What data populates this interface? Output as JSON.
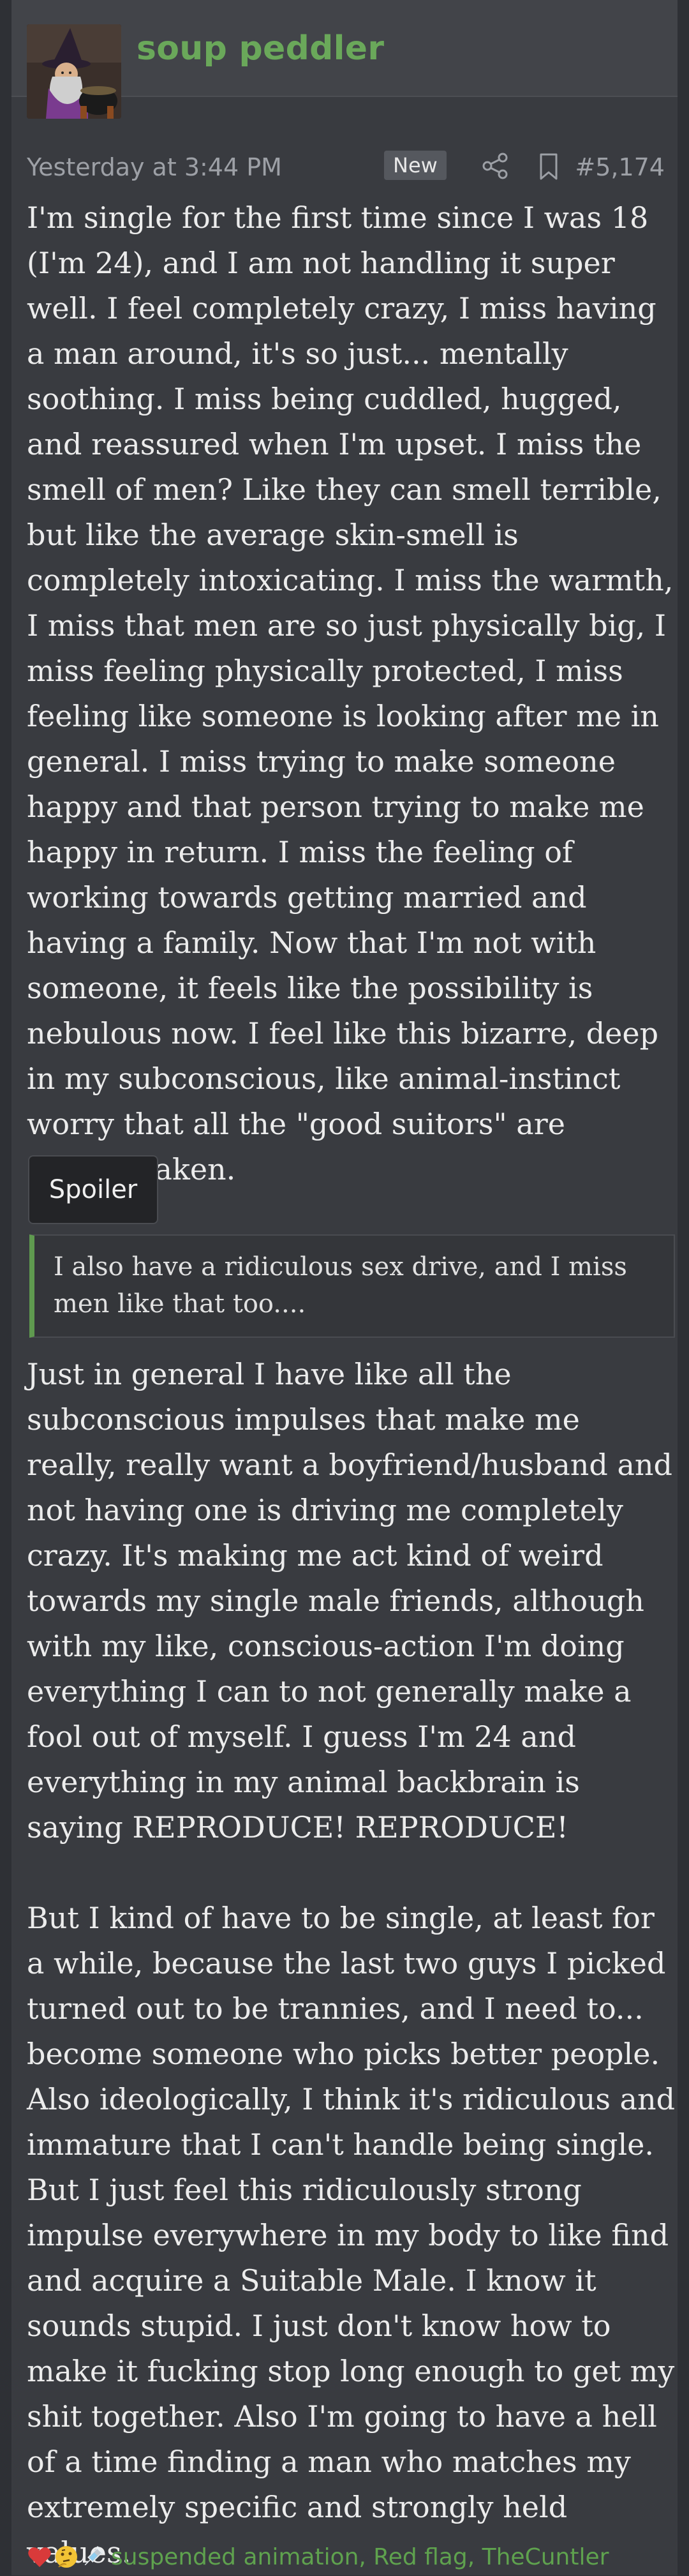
{
  "user": {
    "name": "soup peddler",
    "avatar_icon": "witch-with-cauldron-avatar"
  },
  "post": {
    "timestamp": "Yesterday at 3:44 PM",
    "badge": "New",
    "share_icon": "share-icon",
    "bookmark_icon": "bookmark-icon",
    "number": "#5,174",
    "paragraph_1": "I'm single for the first time since I was 18 (I'm 24), and I am not handling it super well. I feel completely crazy, I miss having a man around, it's so just... mentally soothing. I miss being cuddled, hugged, and reassured when I'm upset. I miss the smell of men? Like they can smell terrible, but like the average skin-smell is completely intoxicating. I miss the warmth, I miss that men are so just physically big, I miss feeling physically protected, I miss feeling like someone is looking after me in general. I miss trying to make someone happy and that person trying to make me happy in return. I miss the feeling of working towards getting married and having a family. Now that I'm not with someone, it feels like the possibility is nebulous now. I feel like this bizarre, deep in my subconscious, like animal-instinct worry that all the \"good suitors\" are getting taken.",
    "spoiler_label": "Spoiler",
    "quote": "I also have a ridiculous sex drive, and I miss men like that too....",
    "paragraph_2": "Just in general I have like all the subconscious impulses that make me really, really want a boyfriend/husband and not having one is driving me completely crazy. It's making me act kind of weird towards my single male friends, although with my like, conscious-action I'm doing everything I can to not generally make a fool out of myself. I guess I'm 24 and everything in my animal backbrain is saying REPRODUCE! REPRODUCE!",
    "paragraph_3": "But I kind of have to be single, at least for a while, because the last two guys I picked turned out to be trannies, and I need to... become someone who picks better people. Also ideologically, I think it's ridiculous and immature that I can't handle being single. But I just feel this ridiculously strong impulse everywhere in my body to like find and acquire a Suitable Male. I know it sounds stupid. I just don't know how to make it fucking stop long enough to get my shit together. Also I'm going to have a hell of a time finding a man who matches my extremely specific and strongly held values."
  },
  "reactions": {
    "icons": [
      "heart-icon",
      "thinking-face-icon",
      "syringe-icon"
    ],
    "names": "suspended animation, Red flag, TheCuntler"
  },
  "colors": {
    "accent_green": "#6aa85a",
    "quote_bar": "#5f9a4f",
    "background": "#2e3035",
    "post_bg": "#393b40"
  }
}
